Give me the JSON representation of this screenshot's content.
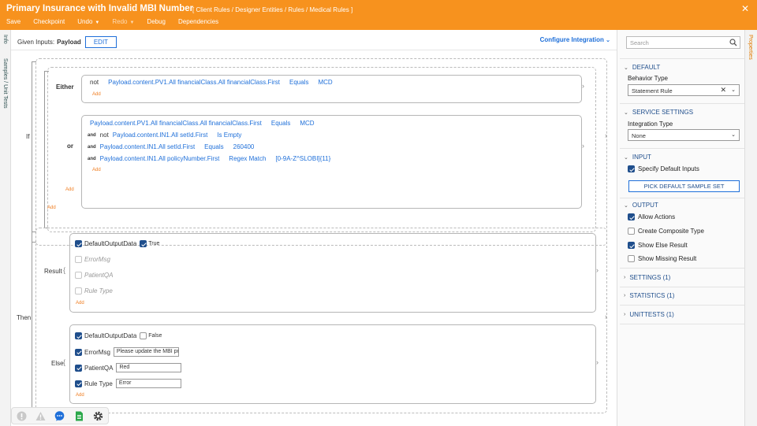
{
  "header": {
    "title": "Primary Insurance with Invalid MBI Number",
    "breadcrumb": "[ Client Rules / Designer Entities / Rules / Medical Rules ]",
    "menu": {
      "save": "Save",
      "checkpoint": "Checkpoint",
      "undo": "Undo",
      "redo": "Redo",
      "debug": "Debug",
      "dependencies": "Dependencies"
    }
  },
  "left_tabs": {
    "info": "Info",
    "samples": "Samples / Unit Tests"
  },
  "right_tab": "Properties",
  "toolbar": {
    "given_inputs_label": "Given Inputs:",
    "given_inputs_value": "Payload",
    "edit_label": "EDIT",
    "configure_integration": "Configure Integration"
  },
  "rule": {
    "if_label": "If",
    "either_label": "Either",
    "or_label": "or",
    "then_label": "Then",
    "add": "Add",
    "either_conditions": [
      {
        "prefix": "not",
        "path": "Payload.content.PV1.All financialClass.All financialClass.First",
        "op": "Equals",
        "value": "MCD"
      }
    ],
    "or_conditions": [
      {
        "joiner": "",
        "prefix": "",
        "path": "Payload.content.PV1.All financialClass.All financialClass.First",
        "op": "Equals",
        "value": "MCD"
      },
      {
        "joiner": "and",
        "prefix": "not",
        "path": "Payload.content.IN1.All setId.First",
        "op": "Is Empty",
        "value": ""
      },
      {
        "joiner": "and",
        "prefix": "",
        "path": "Payload.content.IN1.All setId.First",
        "op": "Equals",
        "value": "260400"
      },
      {
        "joiner": "and",
        "prefix": "",
        "path": "Payload.content.IN1.All policyNumber.First",
        "op": "Regex Match",
        "value": "[0-9A-Z^SLOBI]{11}"
      }
    ],
    "result": {
      "label": "Result",
      "items": [
        {
          "name": "DefaultOutputData",
          "checked": true,
          "value": "True"
        },
        {
          "name": "ErrorMsg",
          "checked": false
        },
        {
          "name": "PatientQA",
          "checked": false
        },
        {
          "name": "Rule Type",
          "checked": false
        }
      ]
    },
    "else": {
      "label": "Else",
      "items": [
        {
          "name": "DefaultOutputData",
          "checked": true,
          "value": "False"
        },
        {
          "name": "ErrorMsg",
          "checked": true,
          "value": "Please update the MBI pr"
        },
        {
          "name": "PatientQA",
          "checked": true,
          "value": "Red"
        },
        {
          "name": "Rule Type",
          "checked": true,
          "value": "Error"
        }
      ]
    }
  },
  "panel": {
    "search_placeholder": "Search",
    "default_section": "DEFAULT",
    "behavior_type_label": "Behavior Type",
    "behavior_type_value": "Statement Rule",
    "service_settings_section": "SERVICE SETTINGS",
    "integration_type_label": "Integration Type",
    "integration_type_value": "None",
    "input_section": "INPUT",
    "specify_default_inputs": "Specify Default Inputs",
    "pick_default_sample_set": "PICK DEFAULT SAMPLE SET",
    "output_section": "OUTPUT",
    "allow_actions": "Allow Actions",
    "create_composite_type": "Create Composite Type",
    "show_else_result": "Show Else Result",
    "show_missing_result": "Show Missing Result",
    "settings_section": "SETTINGS (1)",
    "statistics_section": "STATISTICS (1)",
    "unittests_section": "UNITTESTS (1)"
  },
  "colors": {
    "header": "#f7921e",
    "link": "#1e6fd9",
    "add": "#f07d20",
    "checkbox": "#1f4e8c"
  }
}
